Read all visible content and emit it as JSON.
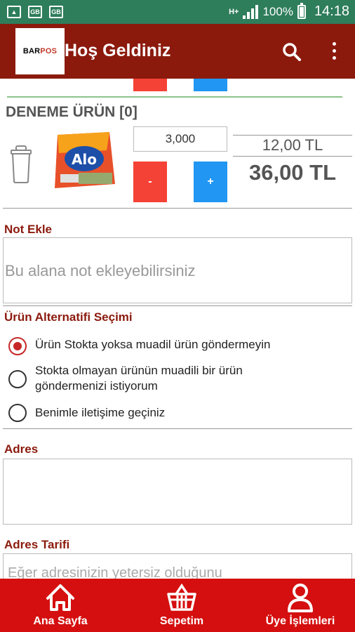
{
  "statusbar": {
    "network": "H+",
    "battery": "100%",
    "time": "14:18"
  },
  "appbar": {
    "logo_text_a": "BAR",
    "logo_text_b": "POS",
    "title": "Hoş Geldiniz"
  },
  "product": {
    "name": "DENEME ÜRÜN [0]",
    "quantity": "3,000",
    "minus_label": "-",
    "plus_label": "+",
    "unit_price": "12,00 TL",
    "total_price": "36,00 TL",
    "image_brand": "Alo"
  },
  "note": {
    "label": "Not Ekle",
    "placeholder": "Bu alana not ekleyebilirsiniz"
  },
  "alternative": {
    "label": "Ürün Alternatifi Seçimi",
    "options": [
      {
        "line1": "Ürün Stokta yoksa muadil ürün göndermeyin",
        "line2": "",
        "selected": true
      },
      {
        "line1": "Stokta olmayan ürünün muadili bir ürün",
        "line2": "göndermenizi istiyorum",
        "selected": false
      },
      {
        "line1": "Benimle iletişime geçiniz",
        "line2": "",
        "selected": false
      }
    ]
  },
  "address": {
    "label": "Adres",
    "value": ""
  },
  "address_desc": {
    "label": "Adres Tarifi",
    "placeholder": "Eğer adresinizin yetersiz olduğunu"
  },
  "bottomnav": {
    "items": [
      {
        "label": "Ana Sayfa",
        "icon": "home-icon"
      },
      {
        "label": "Sepetim",
        "icon": "basket-icon"
      },
      {
        "label": "Üye İşlemleri",
        "icon": "user-icon"
      }
    ]
  },
  "colors": {
    "statusbar": "#2e7d5b",
    "appbar": "#8b1a0d",
    "bottomnav": "#d50f0f",
    "minus": "#f44336",
    "plus": "#2196f3",
    "section_label": "#8b1a0d"
  }
}
